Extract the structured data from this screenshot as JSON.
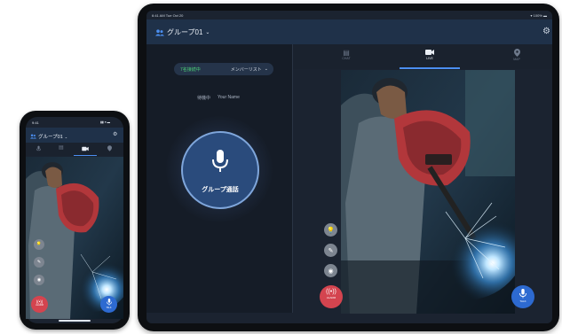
{
  "tablet": {
    "status_time": "6:41 AM  Tue Oct 20",
    "status_right": "▾ 100% ▬",
    "group_name": "グループ01",
    "online_count": "7名接続中",
    "member_list_label": "メンバーリスト",
    "standby_label": "待機中",
    "user_name": "Your Name",
    "ptt_label": "グループ通話",
    "tabs": [
      {
        "icon": "chat-icon",
        "glyph": "▤",
        "label": "CHAT"
      },
      {
        "icon": "live-icon",
        "glyph": "■",
        "label": "LIVE"
      },
      {
        "icon": "map-pin-icon",
        "glyph": "⬤",
        "label": "MAP"
      }
    ],
    "alarm_label": "ALARM",
    "talk_label": "TALK"
  },
  "phone": {
    "status_time": "9:41",
    "status_right": "▮▮ ▾ ▬",
    "group_name": "グループ01",
    "alarm_label": "ALARM",
    "talk_label": "TALK"
  },
  "colors": {
    "accent_blue": "#2d6ad1",
    "online_green": "#4cd37a",
    "alarm_red": "#d4444f",
    "header_navy": "#1f3149"
  }
}
